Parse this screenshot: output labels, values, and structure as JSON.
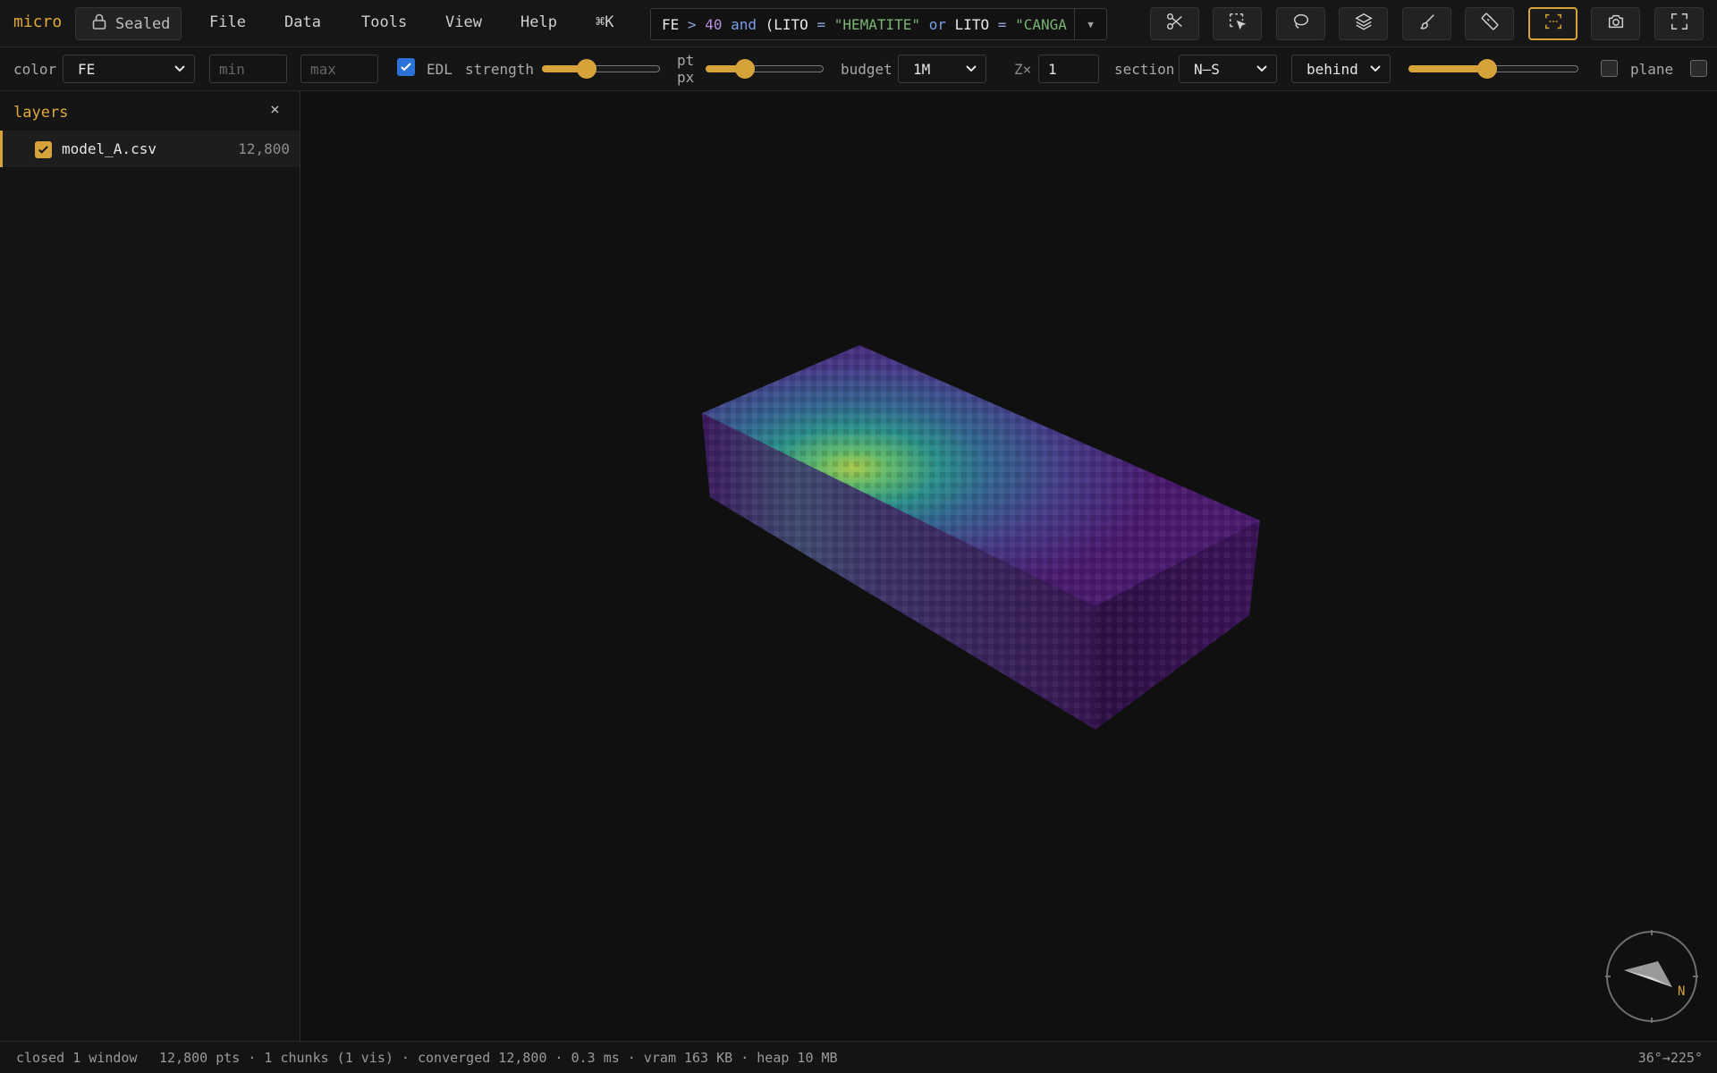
{
  "app": {
    "brand": "micro",
    "sealed_label": "Sealed"
  },
  "menu": {
    "file": "File",
    "data": "Data",
    "tools": "Tools",
    "view": "View",
    "help": "Help",
    "command": "⌘K"
  },
  "query": {
    "parts": [
      "FE",
      ">",
      "40",
      "and",
      "(LITO",
      "=",
      "\"HEMATITE\"",
      "or",
      "LITO",
      "=",
      "\"CANGA"
    ]
  },
  "tools": [
    {
      "name": "scissors-icon"
    },
    {
      "name": "box-select-icon"
    },
    {
      "name": "lasso-icon"
    },
    {
      "name": "layers-icon"
    },
    {
      "name": "brush-icon"
    },
    {
      "name": "ruler-icon"
    },
    {
      "name": "frame-icon",
      "active": true
    },
    {
      "name": "camera-icon"
    },
    {
      "name": "fullscreen-icon"
    }
  ],
  "toolbar": {
    "color_label": "color",
    "color_value": "FE",
    "min_placeholder": "min",
    "max_placeholder": "max",
    "edl_label": "EDL",
    "edl_checked": true,
    "strength_label": "strength",
    "strength_value": 0.35,
    "pt_label": "pt",
    "px_label": "px",
    "pt_value": 0.3,
    "budget_label": "budget",
    "budget_value": "1M",
    "z_label": "Z×",
    "z_value": "1",
    "section_label": "section",
    "section_value": "N–S",
    "behind_value": "behind",
    "section_slider_value": 0.46,
    "plane_label": "plane"
  },
  "sidebar": {
    "title": "layers",
    "close": "×",
    "layers": [
      {
        "name": "model_A.csv",
        "count": "12,800",
        "checked": true
      }
    ]
  },
  "status": {
    "left": "closed 1 window",
    "stats": "12,800 pts · 1 chunks (1 vis) · converged 12,800 · 0.3 ms · vram 163 KB · heap 10 MB",
    "angle": "36°→225°"
  },
  "compass": {
    "north_label": "N"
  },
  "colors": {
    "accent": "#d6a23a",
    "viridis_low": "#440154",
    "viridis_mid": "#21908c",
    "viridis_high": "#fde725"
  }
}
